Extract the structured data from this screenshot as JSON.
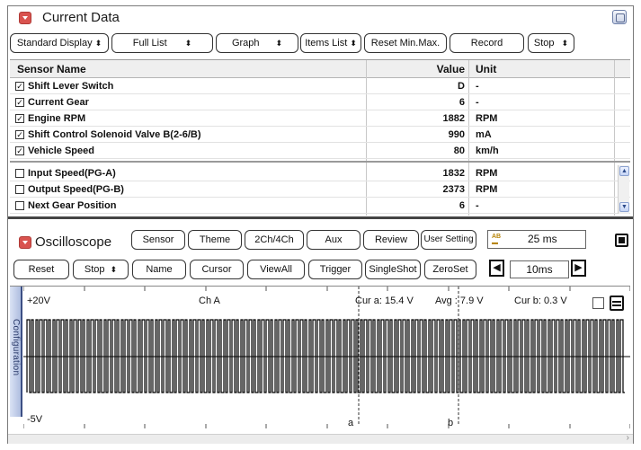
{
  "current_data": {
    "title": "Current Data",
    "toolbar": {
      "display": "Standard Display",
      "list": "Full List",
      "graph": "Graph",
      "items": "Items List",
      "reset": "Reset Min.Max.",
      "record": "Record",
      "stop": "Stop"
    },
    "columns": {
      "name": "Sensor Name",
      "value": "Value",
      "unit": "Unit"
    },
    "fixed_rows": [
      {
        "checked": true,
        "name": "Shift Lever Switch",
        "value": "D",
        "unit": "-"
      },
      {
        "checked": true,
        "name": "Current Gear",
        "value": "6",
        "unit": "-"
      },
      {
        "checked": true,
        "name": "Engine RPM",
        "value": "1882",
        "unit": "RPM"
      },
      {
        "checked": true,
        "name": "Shift Control Solenoid Valve B(2-6/B)",
        "value": "990",
        "unit": "mA"
      },
      {
        "checked": true,
        "name": "Vehicle Speed",
        "value": "80",
        "unit": "km/h"
      }
    ],
    "rows": [
      {
        "checked": false,
        "name": "Input Speed(PG-A)",
        "value": "1832",
        "unit": "RPM"
      },
      {
        "checked": false,
        "name": "Output Speed(PG-B)",
        "value": "2373",
        "unit": "RPM"
      },
      {
        "checked": false,
        "name": "Next Gear Position",
        "value": "6",
        "unit": "-"
      }
    ]
  },
  "oscilloscope": {
    "title": "Oscilloscope",
    "toolbar1": {
      "sensor": "Sensor",
      "theme": "Theme",
      "channels": "2Ch/4Ch",
      "aux": "Aux",
      "review": "Review",
      "user_setting": "User Setting",
      "sample_rate": "25 ms"
    },
    "toolbar2": {
      "reset": "Reset",
      "stop": "Stop",
      "name": "Name",
      "cursor": "Cursor",
      "view_all": "ViewAll",
      "trigger": "Trigger",
      "single_shot": "SingleShot",
      "zero_set": "ZeroSet",
      "time_div": "10ms"
    },
    "config_tab": "Configuration",
    "scope": {
      "top_label": "+20V",
      "bottom_label": "-5V",
      "channel": "Ch A",
      "cur_a": "Cur a: 15.4 V",
      "avg": "Avg : 7.9 V",
      "cur_b": "Cur b: 0.3 V",
      "cursor_a": "a",
      "cursor_b": "b"
    }
  },
  "colors": {
    "accent_red": "#d9534f",
    "trace": "#000000",
    "config_tab": "#aebddf"
  },
  "icons": [
    "collapse-icon",
    "maximize-icon",
    "stop-icon",
    "prev-icon",
    "next-icon",
    "memory-icon",
    "ab-icon"
  ]
}
